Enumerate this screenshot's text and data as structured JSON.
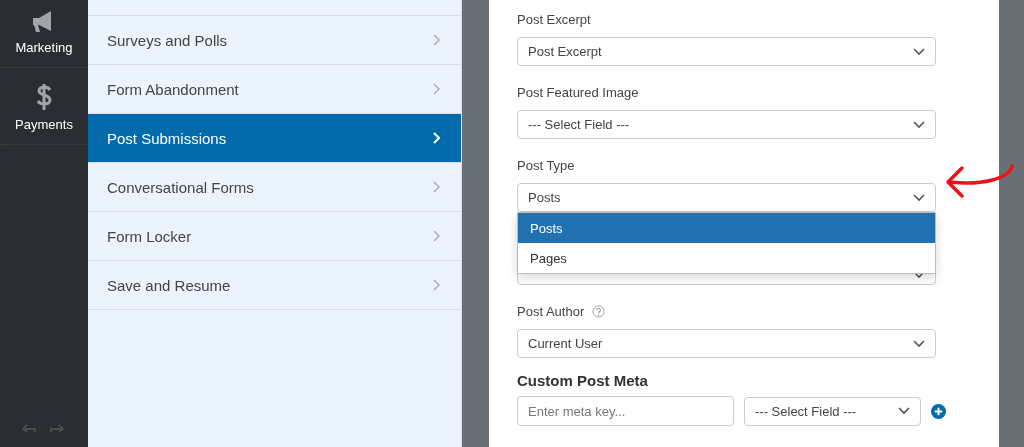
{
  "sidebar": {
    "items": [
      {
        "label": "Marketing",
        "kind": "marketing",
        "selected": false
      },
      {
        "label": "Payments",
        "kind": "payments",
        "selected": false
      }
    ]
  },
  "settings_menu": {
    "items": [
      {
        "label": "Surveys and Polls",
        "selected": false
      },
      {
        "label": "Form Abandonment",
        "selected": false
      },
      {
        "label": "Post Submissions",
        "selected": true
      },
      {
        "label": "Conversational Forms",
        "selected": false
      },
      {
        "label": "Form Locker",
        "selected": false
      },
      {
        "label": "Save and Resume",
        "selected": false
      }
    ]
  },
  "form": {
    "fields": [
      {
        "kind": "select",
        "label": "Post Excerpt",
        "value": "Post Excerpt"
      },
      {
        "kind": "select",
        "label": "Post Featured Image",
        "value": "--- Select Field ---"
      },
      {
        "kind": "select",
        "label": "Post Type",
        "value": "Posts",
        "expanded": true,
        "options": [
          {
            "label": "Posts",
            "selected": true
          },
          {
            "label": "Pages",
            "selected": false
          }
        ]
      },
      {
        "kind": "select"
      },
      {
        "kind": "select",
        "label": "Post Author",
        "help": true,
        "value": "Current User"
      }
    ],
    "custom_meta": {
      "heading": "Custom Post Meta",
      "key_placeholder": "Enter meta key...",
      "field_value": "--- Select Field ---"
    }
  }
}
